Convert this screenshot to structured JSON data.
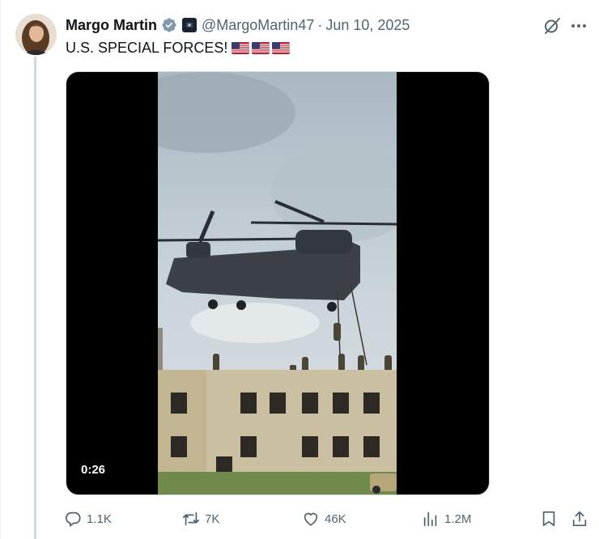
{
  "tweet": {
    "author_name": "Margo Martin",
    "handle": "@MargoMartin47",
    "separator": "·",
    "date": "Jun 10, 2025",
    "text": "U.S. SPECIAL FORCES!",
    "flags": [
      "us-flag",
      "us-flag",
      "us-flag"
    ]
  },
  "media": {
    "duration": "0:26"
  },
  "actions": {
    "replies": "1.1K",
    "reposts": "7K",
    "likes": "46K",
    "views": "1.2M"
  },
  "colors": {
    "text_primary": "#0f1419",
    "text_secondary": "#536471",
    "verified_blue": "#1d9bf0",
    "thread_line": "#cfd9de"
  },
  "icons": {
    "header": [
      "verified-badge-icon",
      "affiliation-badge-icon",
      "grok-icon",
      "more-icon"
    ],
    "actions": [
      "reply-icon",
      "repost-icon",
      "like-icon",
      "views-icon",
      "bookmark-icon",
      "share-icon"
    ]
  }
}
